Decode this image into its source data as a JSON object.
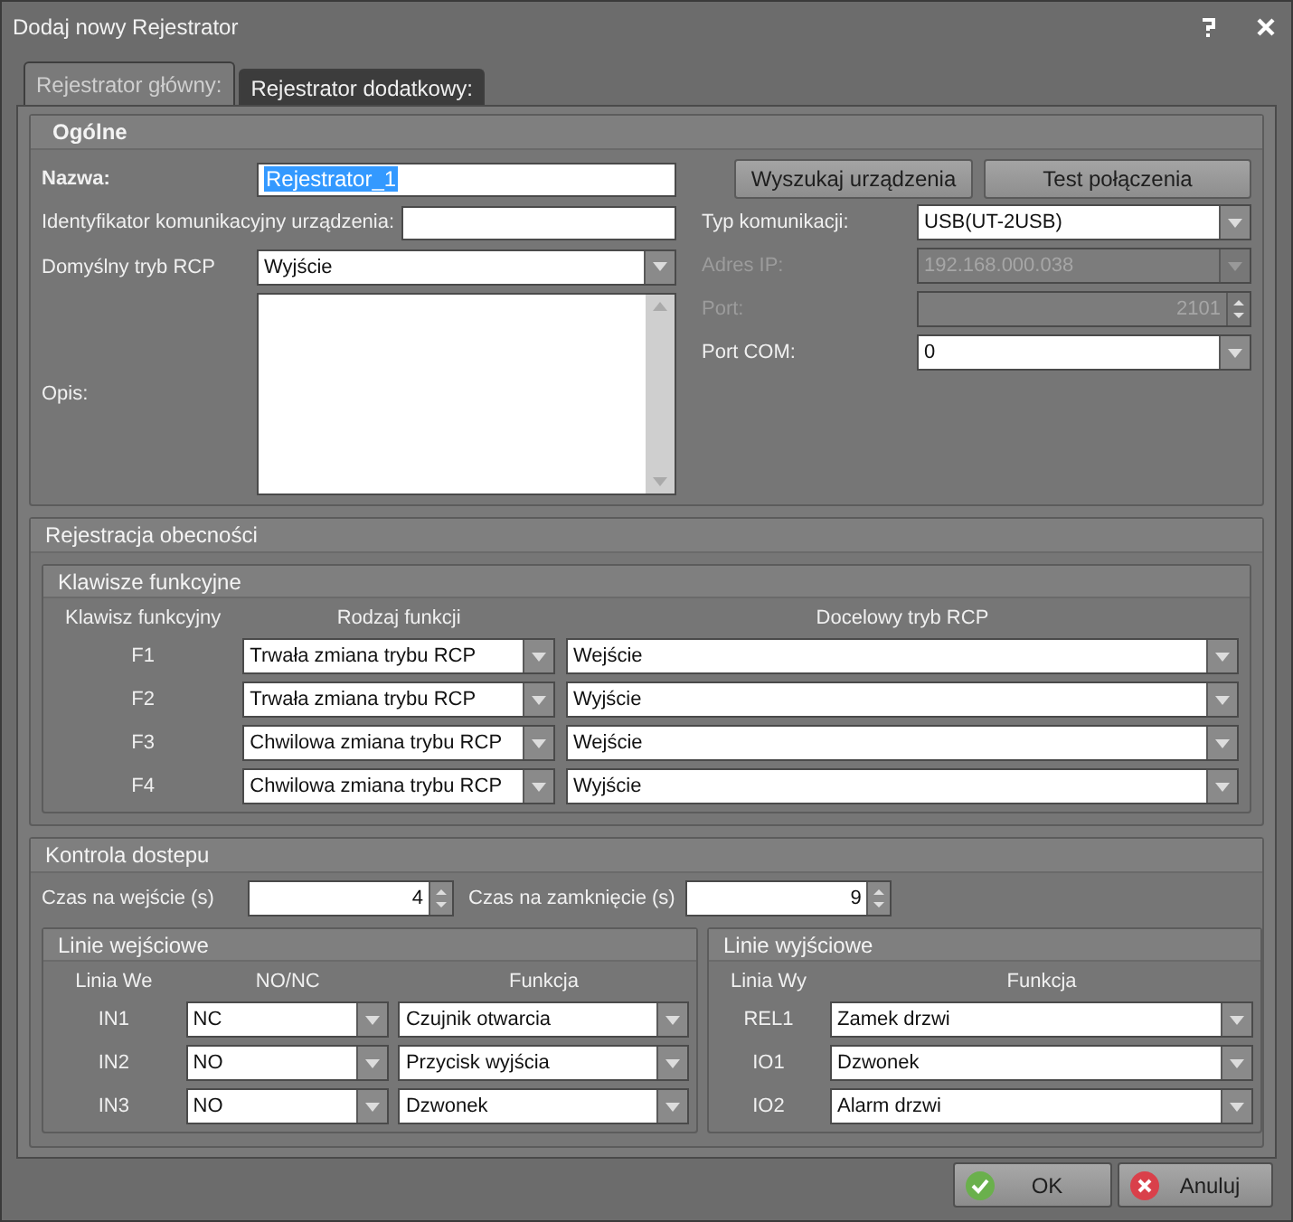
{
  "window": {
    "title": "Dodaj nowy Rejestrator"
  },
  "tabs": [
    {
      "label": "Rejestrator główny:",
      "selected": true
    },
    {
      "label": "Rejestrator dodatkowy:",
      "selected": false
    }
  ],
  "general": {
    "title": "Ogólne",
    "name": {
      "label": "Nazwa:",
      "value": "Rejestrator_1",
      "text_selected": true
    },
    "device_id": {
      "label": "Identyfikator komunikacyjny urządzenia:"
    },
    "default_mode": {
      "label": "Domyślny tryb RCP",
      "value": "Wyjście"
    },
    "description": {
      "label": "Opis:"
    },
    "actions": [
      {
        "label": "Wyszukaj urządzenia"
      },
      {
        "label": "Test połączenia"
      }
    ],
    "connection": [
      {
        "kind": "select",
        "label": "Typ komunikacji:",
        "value": "USB(UT-2USB)",
        "disabled": false
      },
      {
        "kind": "select",
        "label": "Adres IP:",
        "value": "192.168.000.038",
        "disabled": true
      },
      {
        "kind": "spin",
        "label": "Port:",
        "value": "2101",
        "disabled": true
      },
      {
        "kind": "select",
        "label": "Port COM:",
        "value": "0",
        "disabled": false
      }
    ]
  },
  "attendance": {
    "title": "Rejestracja obecności",
    "function_keys": {
      "title": "Klawisze funkcyjne",
      "columns": [
        "Klawisz funkcyjny",
        "Rodzaj funkcji",
        "Docelowy tryb RCP"
      ],
      "rows": [
        {
          "key": "F1",
          "function": "Trwała zmiana trybu RCP",
          "target": "Wejście"
        },
        {
          "key": "F2",
          "function": "Trwała zmiana trybu RCP",
          "target": "Wyjście"
        },
        {
          "key": "F3",
          "function": "Chwilowa zmiana trybu RCP",
          "target": "Wejście"
        },
        {
          "key": "F4",
          "function": "Chwilowa zmiana trybu RCP",
          "target": "Wyjście"
        }
      ]
    }
  },
  "access": {
    "title": "Kontrola dostepu",
    "entry_time": {
      "label": "Czas na wejście (s)",
      "value": "4"
    },
    "close_time": {
      "label": "Czas na zamknięcie (s)",
      "value": "9"
    },
    "inputs": {
      "title": "Linie wejściowe",
      "columns": [
        "Linia We",
        "NO/NC",
        "Funkcja"
      ],
      "rows": [
        {
          "line": "IN1",
          "mode": "NC",
          "function": "Czujnik otwarcia"
        },
        {
          "line": "IN2",
          "mode": "NO",
          "function": "Przycisk wyjścia"
        },
        {
          "line": "IN3",
          "mode": "NO",
          "function": "Dzwonek"
        }
      ]
    },
    "outputs": {
      "title": "Linie wyjściowe",
      "columns": [
        "Linia Wy",
        "Funkcja"
      ],
      "rows": [
        {
          "line": "REL1",
          "function": "Zamek drzwi"
        },
        {
          "line": "IO1",
          "function": "Dzwonek"
        },
        {
          "line": "IO2",
          "function": "Alarm drzwi"
        }
      ]
    }
  },
  "buttons": [
    {
      "kind": "ok",
      "label": "OK"
    },
    {
      "kind": "cancel",
      "label": "Anuluj"
    }
  ]
}
